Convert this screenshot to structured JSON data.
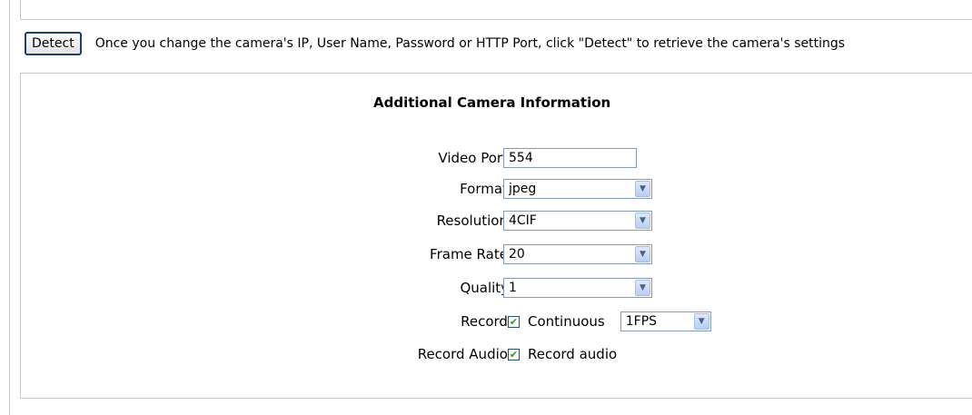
{
  "detect": {
    "button_label": "Detect",
    "message": "Once you change the camera's IP, User Name, Password or HTTP Port, click \"Detect\" to retrieve the camera's settings"
  },
  "panel": {
    "title": "Additional Camera Information",
    "video_port": {
      "label": "Video Port:",
      "value": "554"
    },
    "format": {
      "label": "Format:",
      "value": "jpeg"
    },
    "resolution": {
      "label": "Resolution:",
      "value": "4CIF"
    },
    "frame_rate": {
      "label": "Frame Rate:",
      "value": "20"
    },
    "quality": {
      "label": "Quality:",
      "value": "1"
    },
    "record": {
      "label": "Record:",
      "checked": true,
      "checkbox_label": "Continuous",
      "fps_value": "1FPS"
    },
    "record_audio": {
      "label": "Record Audio:",
      "checked": true,
      "checkbox_label": "Record audio"
    }
  },
  "icons": {
    "dropdown": "chevron-down-icon",
    "check": "checkmark-icon"
  }
}
